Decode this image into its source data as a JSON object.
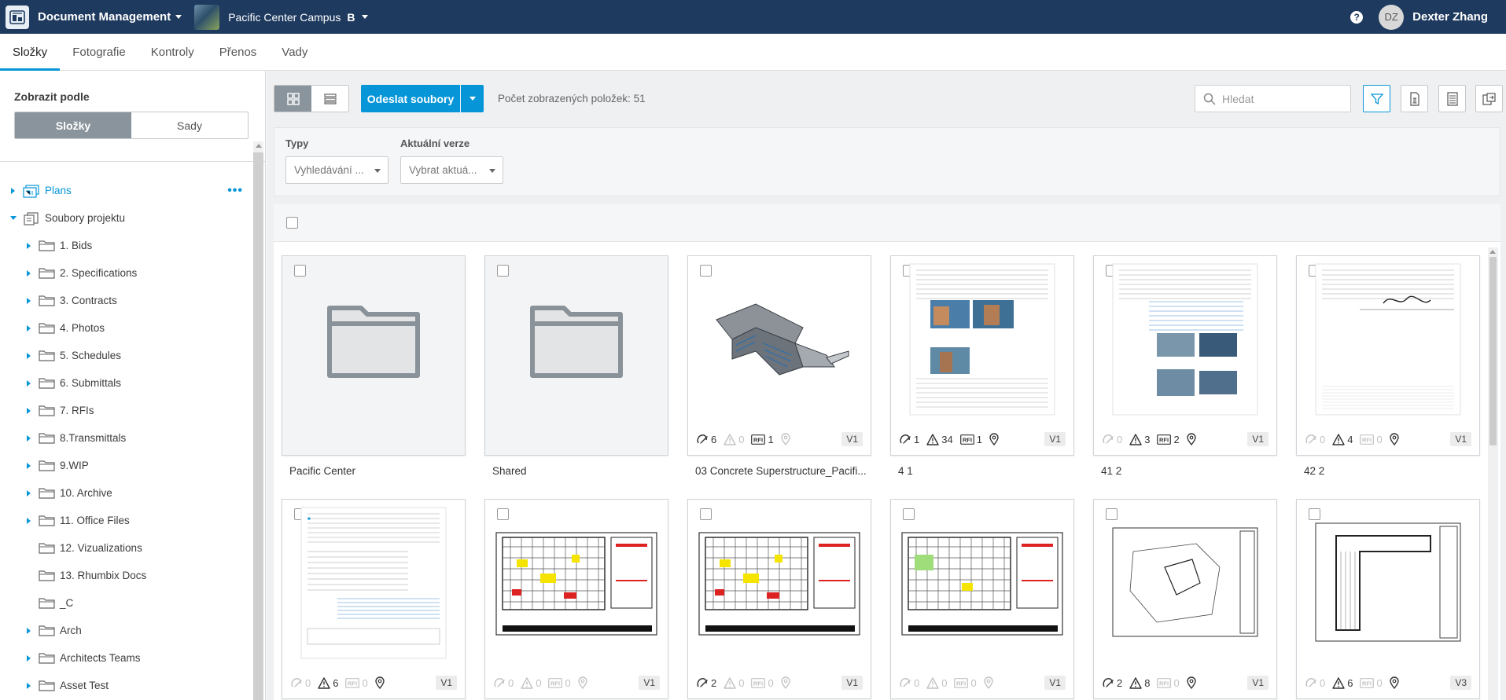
{
  "app": {
    "title": "Document Management",
    "project_name": "Pacific Center Campus",
    "project_badge": "B",
    "help_glyph": "?",
    "user_initials": "DZ",
    "user_name": "Dexter Zhang"
  },
  "tabs": [
    {
      "label": "Složky",
      "active": true
    },
    {
      "label": "Fotografie",
      "active": false
    },
    {
      "label": "Kontroly",
      "active": false
    },
    {
      "label": "Přenos",
      "active": false
    },
    {
      "label": "Vady",
      "active": false
    }
  ],
  "sidebar": {
    "view_label": "Zobrazit podle",
    "segments": [
      {
        "label": "Složky",
        "active": true
      },
      {
        "label": "Sady",
        "active": false
      }
    ],
    "tree": [
      {
        "label": "Plans",
        "level": 0,
        "expand": "right",
        "icon": "plans-set-icon",
        "more": "•••"
      },
      {
        "label": "Soubory projektu",
        "level": 0,
        "expand": "down",
        "icon": "project-files-icon"
      },
      {
        "label": "1. Bids",
        "level": 1,
        "expand": "right",
        "icon": "folder-icon"
      },
      {
        "label": "2. Specifications",
        "level": 1,
        "expand": "right",
        "icon": "folder-icon"
      },
      {
        "label": "3. Contracts",
        "level": 1,
        "expand": "right",
        "icon": "folder-icon"
      },
      {
        "label": "4. Photos",
        "level": 1,
        "expand": "right",
        "icon": "folder-icon"
      },
      {
        "label": "5. Schedules",
        "level": 1,
        "expand": "right",
        "icon": "folder-icon"
      },
      {
        "label": "6. Submittals",
        "level": 1,
        "expand": "right",
        "icon": "folder-icon"
      },
      {
        "label": "7. RFIs",
        "level": 1,
        "expand": "right",
        "icon": "folder-icon"
      },
      {
        "label": "8.Transmittals",
        "level": 1,
        "expand": "right",
        "icon": "folder-icon"
      },
      {
        "label": "9.WIP",
        "level": 1,
        "expand": "right",
        "icon": "folder-icon"
      },
      {
        "label": "10. Archive",
        "level": 1,
        "expand": "right",
        "icon": "folder-icon"
      },
      {
        "label": "11. Office Files",
        "level": 1,
        "expand": "right",
        "icon": "folder-icon"
      },
      {
        "label": "12. Vizualizations",
        "level": 1,
        "expand": "none",
        "icon": "folder-icon"
      },
      {
        "label": "13. Rhumbix Docs",
        "level": 1,
        "expand": "none",
        "icon": "folder-icon"
      },
      {
        "label": "_C",
        "level": 1,
        "expand": "none",
        "icon": "folder-icon"
      },
      {
        "label": "Arch",
        "level": 1,
        "expand": "right",
        "icon": "folder-icon"
      },
      {
        "label": "Architects Teams",
        "level": 1,
        "expand": "right",
        "icon": "folder-icon"
      },
      {
        "label": "Asset Test",
        "level": 1,
        "expand": "right",
        "icon": "folder-icon"
      }
    ]
  },
  "toolbar": {
    "upload_label": "Odeslat soubory",
    "count_text": "Počet zobrazených položek: 51",
    "search_placeholder": "Hledat"
  },
  "filters": {
    "types_label": "Typy",
    "types_placeholder": "Vyhledávání ...",
    "version_label": "Aktuální verze",
    "version_placeholder": "Vybrat aktuá..."
  },
  "cards": [
    {
      "name": "Pacific Center",
      "kind": "folder"
    },
    {
      "name": "Shared",
      "kind": "folder"
    },
    {
      "name": "03 Concrete Superstructure_Pacifi...",
      "kind": "model",
      "markups": "6",
      "markups_dim": false,
      "issues": "0",
      "issues_dim": true,
      "rfis": "1",
      "rfis_dim": false,
      "pin_dim": true,
      "version": "V1"
    },
    {
      "name": "4 1",
      "kind": "doc-photos",
      "markups": "1",
      "markups_dim": false,
      "issues": "34",
      "issues_dim": false,
      "rfis": "1",
      "rfis_dim": false,
      "pin_dim": false,
      "version": "V1"
    },
    {
      "name": "41 2",
      "kind": "doc-photos2",
      "markups": "0",
      "markups_dim": true,
      "issues": "3",
      "issues_dim": false,
      "rfis": "2",
      "rfis_dim": false,
      "pin_dim": false,
      "version": "V1"
    },
    {
      "name": "42 2",
      "kind": "doc-signature",
      "markups": "0",
      "markups_dim": true,
      "issues": "4",
      "issues_dim": false,
      "rfis": "0",
      "rfis_dim": true,
      "pin_dim": false,
      "version": "V1"
    },
    {
      "name": "",
      "kind": "doc-form",
      "markups": "0",
      "markups_dim": true,
      "issues": "6",
      "issues_dim": false,
      "rfis": "0",
      "rfis_dim": true,
      "pin_dim": false,
      "version": "V1"
    },
    {
      "name": "",
      "kind": "plan-color",
      "markups": "0",
      "markups_dim": true,
      "issues": "0",
      "issues_dim": true,
      "rfis": "0",
      "rfis_dim": true,
      "pin_dim": true,
      "version": "V1"
    },
    {
      "name": "",
      "kind": "plan-color",
      "markups": "2",
      "markups_dim": false,
      "issues": "0",
      "issues_dim": true,
      "rfis": "0",
      "rfis_dim": true,
      "pin_dim": true,
      "version": "V1"
    },
    {
      "name": "",
      "kind": "plan-green",
      "markups": "0",
      "markups_dim": true,
      "issues": "0",
      "issues_dim": true,
      "rfis": "0",
      "rfis_dim": true,
      "pin_dim": true,
      "version": "V1"
    },
    {
      "name": "",
      "kind": "plan-site",
      "markups": "2",
      "markups_dim": false,
      "issues": "8",
      "issues_dim": false,
      "rfis": "0",
      "rfis_dim": true,
      "pin_dim": false,
      "version": "V1"
    },
    {
      "name": "",
      "kind": "plan-lshape",
      "markups": "0",
      "markups_dim": true,
      "issues": "6",
      "issues_dim": false,
      "rfis": "0",
      "rfis_dim": true,
      "pin_dim": false,
      "version": "V3"
    }
  ],
  "colors": {
    "header_bg": "#1e3a5f",
    "accent": "#0696d7",
    "segment_active": "#8a949c"
  }
}
